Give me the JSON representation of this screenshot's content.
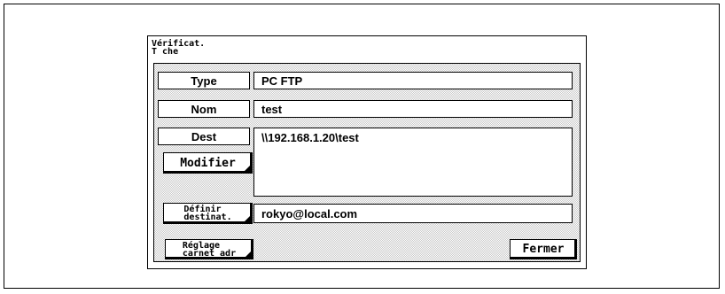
{
  "panel": {
    "title": "Vérificat.\nT che"
  },
  "rows": {
    "type": {
      "label": "Type",
      "value": "PC   FTP"
    },
    "name": {
      "label": "Nom",
      "value": "test"
    },
    "dest": {
      "label": "Dest",
      "value": "\\\\192.168.1.20\\test"
    },
    "email": {
      "value": "rokyo@local.com"
    }
  },
  "buttons": {
    "modify": "Modifier",
    "set_destination": "Définir\ndestinat.",
    "address_book": "Réglage\ncarnet adr",
    "close": "Fermer"
  }
}
